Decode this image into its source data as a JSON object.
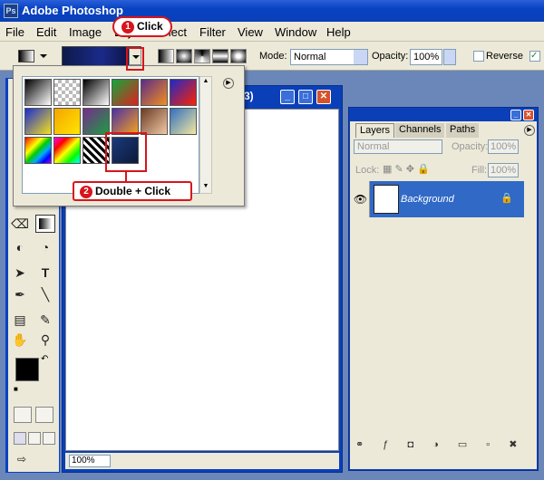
{
  "window": {
    "title": "Adobe Photoshop",
    "app_icon": "Ps"
  },
  "menu": [
    "File",
    "Edit",
    "Image",
    "Layer",
    "Select",
    "Filter",
    "View",
    "Window",
    "Help"
  ],
  "options": {
    "mode_label": "Mode:",
    "mode_value": "Normal",
    "opacity_label": "Opacity:",
    "opacity_value": "100%",
    "reverse_label": "Reverse"
  },
  "gradient_picker": {
    "gradients": [
      [
        "#000000",
        "#ffffff"
      ],
      [
        "checker",
        "#cccccc"
      ],
      [
        "#000000",
        "#ffffff"
      ],
      [
        "#11a83a",
        "#e21f1f"
      ],
      [
        "#5a2c8a",
        "#f28f1e"
      ],
      [
        "#1d29c9",
        "#ff2200"
      ],
      [
        "#1a2bd4",
        "#f6e21a"
      ],
      [
        "#f5a400",
        "#ffe500"
      ],
      [
        "#7a2a8f",
        "#1a9f3f"
      ],
      [
        "#4b2fa8",
        "#f6a21a"
      ],
      [
        "#6b3b25",
        "#f1c9a5"
      ],
      [
        "#2f6fbf",
        "#f5e8a0"
      ],
      [
        "rainbow",
        "rainbow"
      ],
      [
        "rainbow2",
        "checker"
      ],
      [
        "stripes",
        "stripes"
      ],
      [
        "#1a3a7a",
        "#0d1a3a"
      ]
    ]
  },
  "layers": {
    "tabs": [
      "Layers",
      "Channels",
      "Paths"
    ],
    "blend": "Normal",
    "opacity_label": "Opacity:",
    "opacity_value": "100%",
    "lock_label": "Lock:",
    "fill_label": "Fill:",
    "fill_value": "100%",
    "layer_name": "Background"
  },
  "document": {
    "zoom": "100%",
    "title_fragment": "3)"
  },
  "annotations": {
    "step1": "Click",
    "step1_num": "1",
    "step2": "Double + Click",
    "step2_num": "2"
  },
  "colors": {
    "xp_blue": "#0a3fb8",
    "selection_blue": "#3169c6",
    "callout_red": "#d8141c"
  }
}
